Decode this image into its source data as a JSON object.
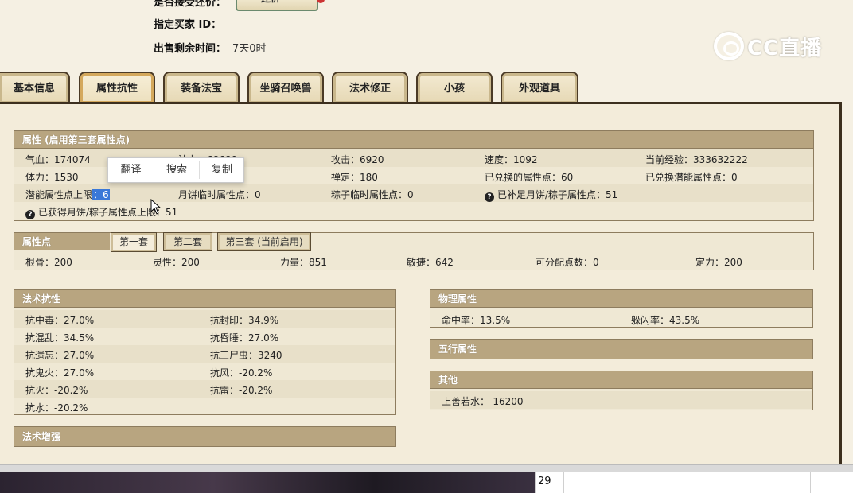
{
  "top": {
    "partial_label": "是否接受还价：",
    "partial_button": "还价",
    "buyer_id_label": "指定买家 ID：",
    "time_left_label": "出售剩余时间：",
    "time_left_value": "7天0时"
  },
  "logo": {
    "text": "CC直播"
  },
  "tabs": [
    "基本信息",
    "属性抗性",
    "装备法宝",
    "坐骑召唤兽",
    "法术修正",
    "小孩",
    "外观道具"
  ],
  "attributes": {
    "title": "属性 (启用第三套属性点)",
    "qixue": "气血：174074",
    "fali": "法力：68680",
    "gongji": "攻击：6920",
    "sudu": "速度：1092",
    "exp": "当前经验：333632222",
    "tili": "体力：1530",
    "chanding": "禅定：180",
    "exchanged": "已兑换的属性点：60",
    "exchanged_potential": "已兑换潜能属性点：0",
    "potential_cap_label": "潜能属性点上限",
    "potential_cap_value": "：6",
    "mooncake_temp": "月饼临时属性点：0",
    "zongzi_temp": "粽子临时属性点：0",
    "filled": "已补足月饼/粽子属性点：51",
    "obtained": "已获得月饼/粽子属性点上限：51"
  },
  "points": {
    "title": "属性点",
    "subtabs": [
      "第一套",
      "第二套",
      "第三套 (当前启用)"
    ],
    "genGu": "根骨：200",
    "lingXing": "灵性：200",
    "liLiang": "力量：851",
    "minJie": "敏捷：642",
    "assignable": "可分配点数：0",
    "dingLi": "定力：200"
  },
  "resist": {
    "title": "法术抗性",
    "items": [
      "抗中毒：27.0%",
      "抗封印：34.9%",
      "抗混乱：34.5%",
      "抗昏睡：27.0%",
      "抗遗忘：27.0%",
      "抗三尸虫：3240",
      "抗鬼火：27.0%",
      "抗风：-20.2%",
      "抗火：-20.2%",
      "抗雷：-20.2%",
      "抗水：-20.2%"
    ]
  },
  "enhance": {
    "title": "法术增强"
  },
  "physical": {
    "title": "物理属性",
    "hit": "命中率：13.5%",
    "dodge": "躲闪率：43.5%"
  },
  "wuxing": {
    "title": "五行属性"
  },
  "other": {
    "title": "其他",
    "shanshui": "上善若水：-16200"
  },
  "context_menu": [
    "翻译",
    "搜索",
    "复制"
  ],
  "taskbar": {
    "cell": "29"
  }
}
